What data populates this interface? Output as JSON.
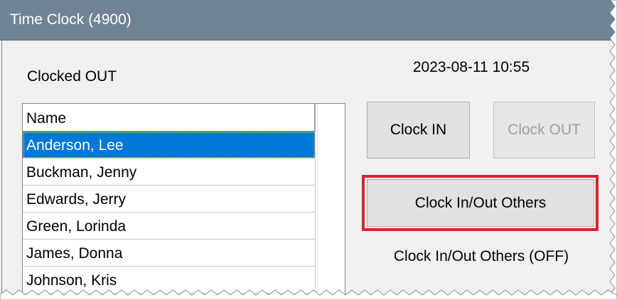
{
  "window": {
    "title": "Time Clock (4900)"
  },
  "status": {
    "label": "Clocked OUT",
    "datetime": "2023-08-11 10:55"
  },
  "list": {
    "column_header": "Name",
    "rows": [
      {
        "name": "Anderson, Lee",
        "selected": true
      },
      {
        "name": "Buckman, Jenny",
        "selected": false
      },
      {
        "name": "Edwards, Jerry",
        "selected": false
      },
      {
        "name": "Green, Lorinda",
        "selected": false
      },
      {
        "name": "James, Donna",
        "selected": false
      },
      {
        "name": "Johnson, Kris",
        "selected": false
      }
    ]
  },
  "buttons": {
    "clock_in": "Clock IN",
    "clock_out": "Clock OUT",
    "clock_others": "Clock In/Out Others"
  },
  "others_status": "Clock In/Out Others (OFF)",
  "colors": {
    "titlebar": "#6f8395",
    "selection": "#0078d7",
    "highlight": "#d6262e"
  }
}
